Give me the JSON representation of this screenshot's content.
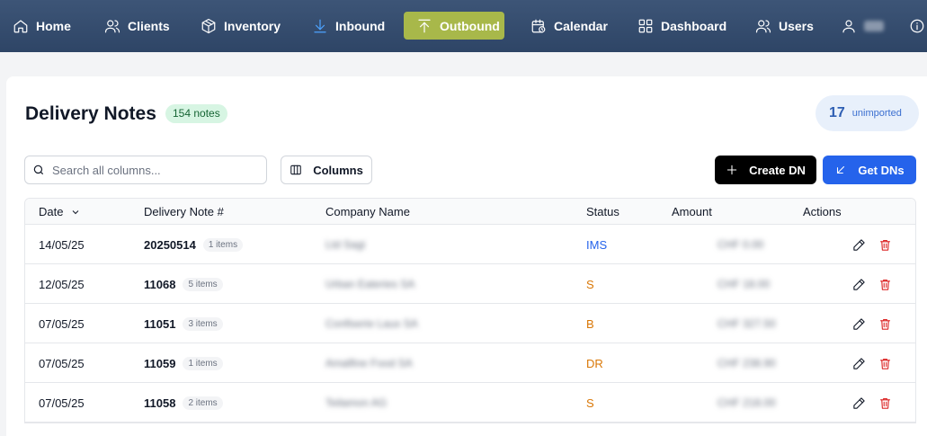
{
  "nav": {
    "home": "Home",
    "clients": "Clients",
    "inventory": "Inventory",
    "inbound": "Inbound",
    "outbound": "Outbound",
    "calendar": "Calendar",
    "dashboard": "Dashboard",
    "users": "Users",
    "active": "Outbound",
    "accent_color": "#a8b84a"
  },
  "header": {
    "title": "Delivery Notes",
    "count_badge": "154 notes",
    "unimported_count": "17",
    "unimported_label": "unimported"
  },
  "toolbar": {
    "search_placeholder": "Search all columns...",
    "columns_label": "Columns",
    "create_label": "Create DN",
    "get_label": "Get DNs"
  },
  "table": {
    "columns": [
      "Date",
      "Delivery Note #",
      "Company Name",
      "Status",
      "Amount",
      "Actions"
    ],
    "sort_column": "Date",
    "rows": [
      {
        "date": "14/05/25",
        "dn": "20250514",
        "items": "1 items",
        "company": "Ltd Sagi",
        "status": "IMS",
        "status_color": "#2563eb",
        "amount": "CHF 0.00"
      },
      {
        "date": "12/05/25",
        "dn": "11068",
        "items": "5 items",
        "company": "Urban Eateries SA",
        "status": "S",
        "status_color": "#d97706",
        "amount": "CHF 18.00"
      },
      {
        "date": "07/05/25",
        "dn": "11051",
        "items": "3 items",
        "company": "Confiserie Laux SA",
        "status": "B",
        "status_color": "#d97706",
        "amount": "CHF 327.50"
      },
      {
        "date": "07/05/25",
        "dn": "11059",
        "items": "1 items",
        "company": "Amalfine Food SA",
        "status": "DR",
        "status_color": "#d97706",
        "amount": "CHF 238.90"
      },
      {
        "date": "07/05/25",
        "dn": "11058",
        "items": "2 items",
        "company": "Teilamon AG",
        "status": "S",
        "status_color": "#d97706",
        "amount": "CHF 218.00"
      }
    ]
  }
}
